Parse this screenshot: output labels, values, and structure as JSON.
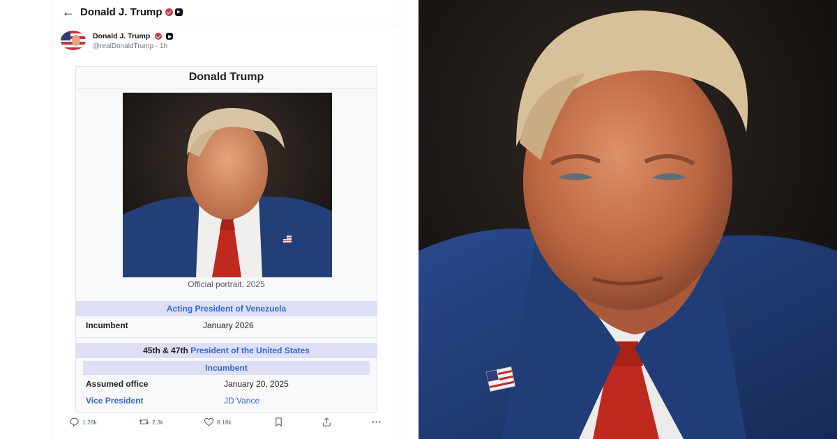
{
  "tweet": {
    "header_title": "Donald J. Trump",
    "author_name": "Donald J. Trump",
    "author_handle": "@realDonaldTrump · 1h",
    "actions": {
      "replies": "1.28k",
      "reposts": "2.3k",
      "likes": "8.18k"
    }
  },
  "infobox": {
    "title": "Donald Trump",
    "caption": "Official portrait, 2025",
    "section1": {
      "heading": "Acting President of Venezuela",
      "row_label": "Incumbent",
      "row_value": "January 2026"
    },
    "section2": {
      "heading_prefix": "45th & 47th",
      "heading_link": "President of the United States",
      "subheading": "Incumbent",
      "rows": [
        {
          "label": "Assumed office",
          "value": "January 20, 2025"
        },
        {
          "label": "Vice President",
          "value": "JD Vance"
        }
      ]
    }
  },
  "colors": {
    "wiki_link": "#3366cc",
    "wiki_band": "#dde0f4",
    "verified_badge": "#c43c4a",
    "suit": "#233f78",
    "tie": "#c0291f"
  },
  "icons": [
    "back-arrow-icon",
    "verified-badge-icon",
    "affiliate-square-icon",
    "reply-icon",
    "repost-icon",
    "like-icon",
    "bookmark-icon",
    "share-icon",
    "more-icon"
  ]
}
